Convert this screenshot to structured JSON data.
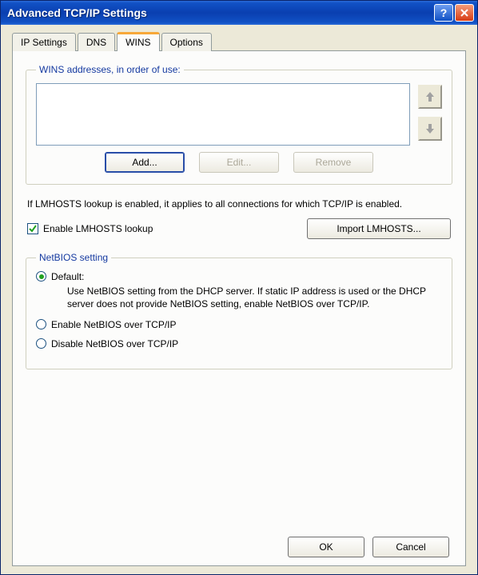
{
  "window": {
    "title": "Advanced TCP/IP Settings"
  },
  "tabs": {
    "ip": "IP Settings",
    "dns": "DNS",
    "wins": "WINS",
    "options": "Options"
  },
  "wins_group": {
    "legend": "WINS addresses, in order of use:",
    "add": "Add...",
    "edit": "Edit...",
    "remove": "Remove"
  },
  "lmhosts": {
    "info": "If LMHOSTS lookup is enabled, it applies to all connections for which TCP/IP is enabled.",
    "checkbox": "Enable LMHOSTS lookup",
    "import": "Import LMHOSTS..."
  },
  "netbios": {
    "legend": "NetBIOS setting",
    "default_label": "Default:",
    "default_desc": "Use NetBIOS setting from the DHCP server. If static IP address is used or the DHCP server does not provide NetBIOS setting, enable NetBIOS over TCP/IP.",
    "enable": "Enable NetBIOS over TCP/IP",
    "disable": "Disable NetBIOS over TCP/IP"
  },
  "footer": {
    "ok": "OK",
    "cancel": "Cancel"
  }
}
